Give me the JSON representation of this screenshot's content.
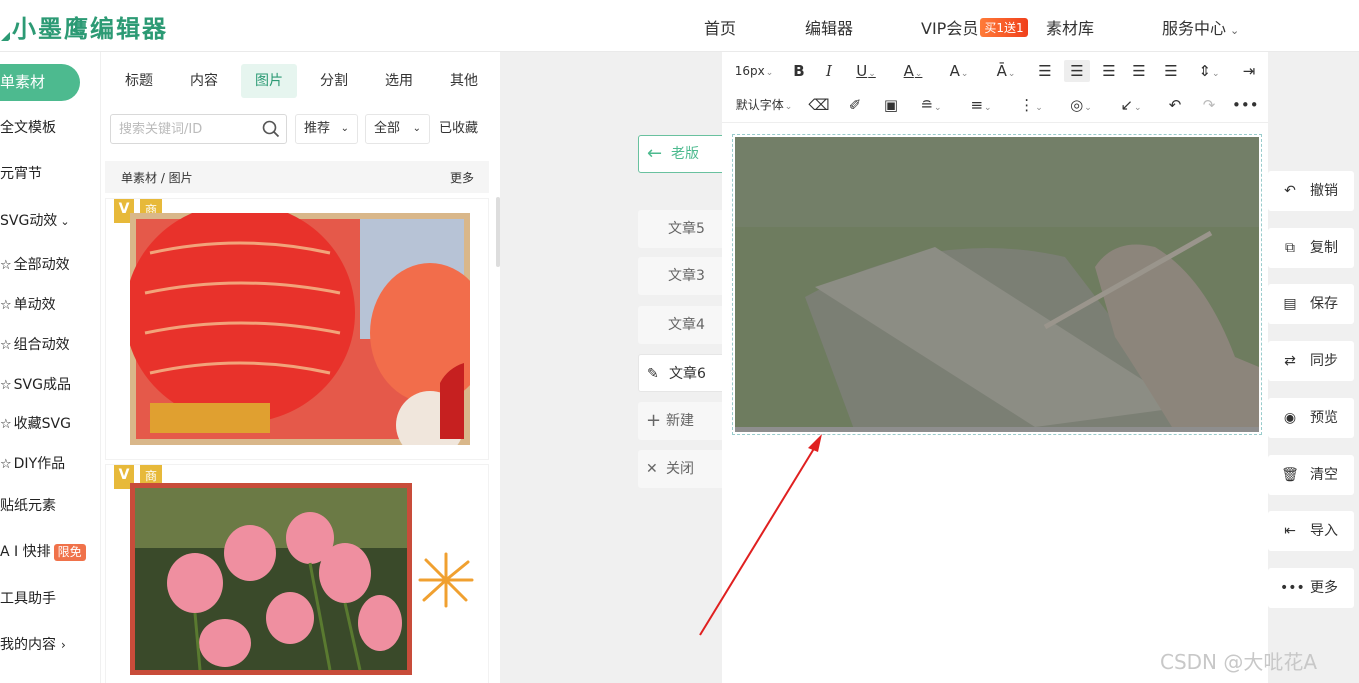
{
  "header": {
    "logo_text": "小墨鹰编辑器",
    "nav": [
      {
        "label": "首页"
      },
      {
        "label": "编辑器"
      },
      {
        "label": "VIP会员",
        "badge": "买1送1"
      },
      {
        "label": "素材库"
      },
      {
        "label": "服务中心"
      }
    ]
  },
  "leftnav": {
    "active": "单素材",
    "items": [
      "全文模板",
      "元宵节",
      "SVG动效",
      "全部动效",
      "单动效",
      "组合动效",
      "SVG成品",
      "收藏SVG",
      "DIY作品",
      "贴纸元素",
      "A I 快排",
      "工具助手",
      "我的内容"
    ],
    "ai_badge": "限免"
  },
  "panel": {
    "tabs": [
      "标题",
      "内容",
      "图片",
      "分割",
      "选用",
      "其他"
    ],
    "active_tab": "图片",
    "search_placeholder": "搜索关键词/ID",
    "dropdowns": [
      "推荐",
      "全部"
    ],
    "favorites": "已收藏",
    "breadcrumb": "单素材 / 图片",
    "more": "更多",
    "tag_v": "V",
    "tag_commercial": "商"
  },
  "middle": {
    "old_version": "老版",
    "docs": [
      "文章5",
      "文章3",
      "文章4",
      "文章6"
    ],
    "new": "新建",
    "close": "关闭"
  },
  "editor": {
    "font_size": "16px",
    "default_font": "默认字体"
  },
  "actions": [
    "撤销",
    "复制",
    "保存",
    "同步",
    "预览",
    "清空",
    "导入",
    "更多"
  ],
  "watermark": "CSDN @大吡花A",
  "colors": {
    "brand": "#2c9a74",
    "active_nav": "#4dba8f",
    "vip_badge": "#f0401c"
  }
}
